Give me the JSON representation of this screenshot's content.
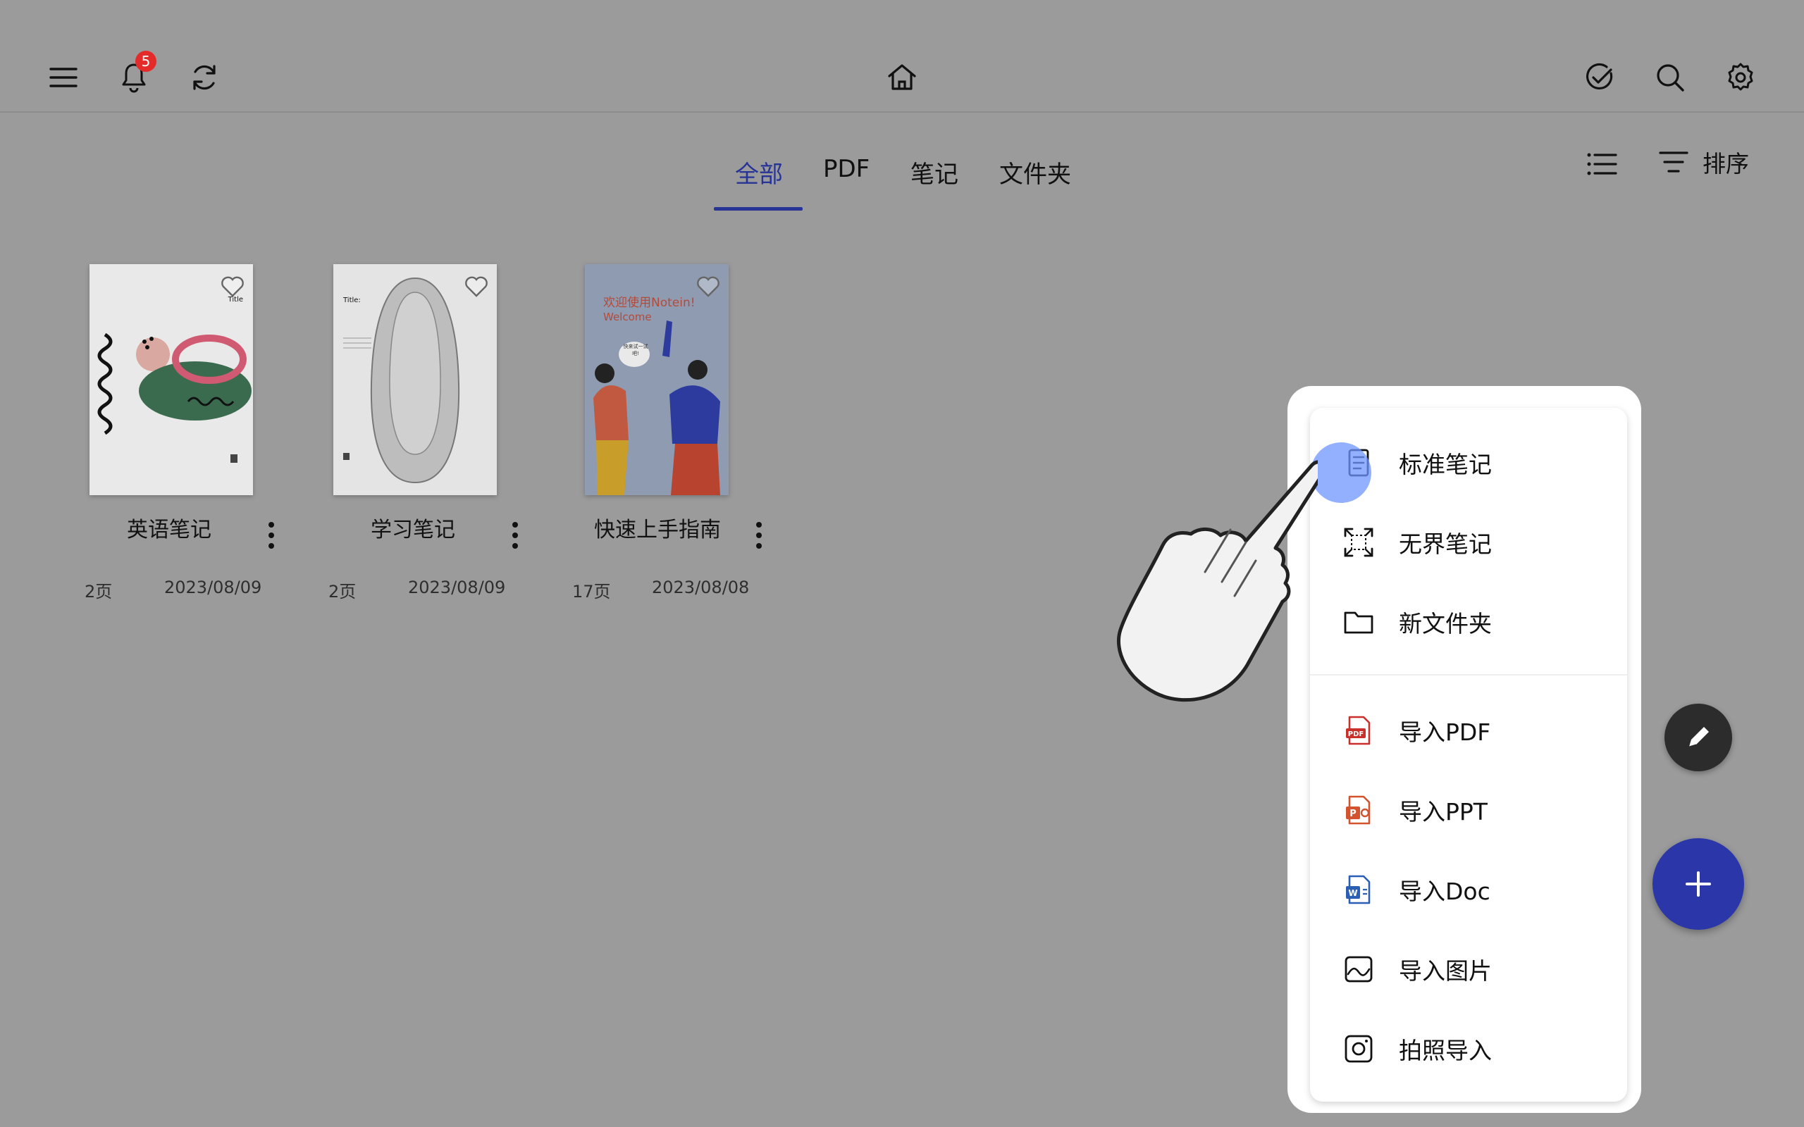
{
  "header": {
    "notification_count": "5"
  },
  "tabs": [
    {
      "label": "全部",
      "active": true
    },
    {
      "label": "PDF",
      "active": false
    },
    {
      "label": "笔记",
      "active": false
    },
    {
      "label": "文件夹",
      "active": false
    }
  ],
  "toolbar": {
    "sort_label": "排序"
  },
  "documents": [
    {
      "title": "英语笔记",
      "pages": "2页",
      "date": "2023/08/09",
      "cover_text": "Title"
    },
    {
      "title": "学习笔记",
      "pages": "2页",
      "date": "2023/08/09",
      "cover_text": "Title:"
    },
    {
      "title": "快速上手指南",
      "pages": "17页",
      "date": "2023/08/08",
      "cover_text": "欢迎使用Notein!",
      "cover_text2": "Welcome",
      "cover_bubble": "快来试一试吧!"
    }
  ],
  "menu": {
    "create_items": [
      {
        "label": "标准笔记",
        "icon": "standard-note-icon"
      },
      {
        "label": "无界笔记",
        "icon": "infinite-canvas-icon"
      },
      {
        "label": "新文件夹",
        "icon": "folder-icon"
      }
    ],
    "import_items": [
      {
        "label": "导入PDF",
        "icon": "pdf-icon"
      },
      {
        "label": "导入PPT",
        "icon": "ppt-icon"
      },
      {
        "label": "导入Doc",
        "icon": "doc-icon"
      },
      {
        "label": "导入图片",
        "icon": "image-icon"
      },
      {
        "label": "拍照导入",
        "icon": "camera-icon"
      }
    ],
    "pdf_badge": "PDF",
    "ppt_badge": "P",
    "doc_badge": "W"
  },
  "colors": {
    "accent": "#273495",
    "fab_add": "#2b36a8",
    "fab_edit": "#2c2c2c",
    "badge": "#e52a2a",
    "overlay_bg": "#9b9b9b"
  }
}
